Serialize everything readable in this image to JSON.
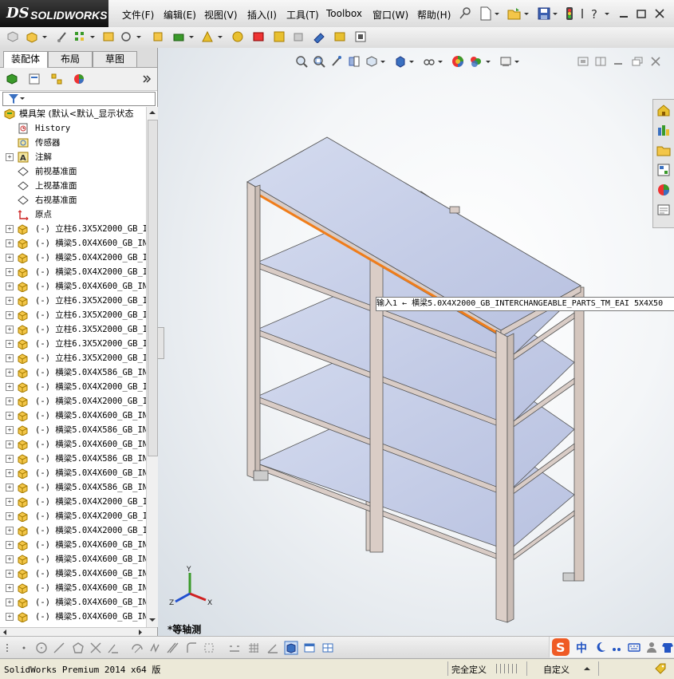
{
  "app": {
    "logo_ds": "DS",
    "logo_text": "SOLIDWORKS",
    "status_version": "SolidWorks Premium 2014 x64 版",
    "status_define": "完全定义",
    "status_custom": "自定义"
  },
  "menu": [
    {
      "label": "文件(F)"
    },
    {
      "label": "编辑(E)"
    },
    {
      "label": "视图(V)"
    },
    {
      "label": "插入(I)"
    },
    {
      "label": "工具(T)"
    },
    {
      "label": "Toolbox"
    },
    {
      "label": "窗口(W)"
    },
    {
      "label": "帮助(H)"
    }
  ],
  "tabs": [
    {
      "label": "装配体"
    },
    {
      "label": "布局"
    },
    {
      "label": "草图"
    }
  ],
  "tree": {
    "root": "模具架  (默认<默认_显示状态",
    "items": [
      {
        "label": "History",
        "icon": "history-icon",
        "expand": false
      },
      {
        "label": "传感器",
        "icon": "sensor-icon",
        "expand": false
      },
      {
        "label": "注解",
        "icon": "annotation-icon",
        "expand": true
      },
      {
        "label": "前视基准面",
        "icon": "plane-icon",
        "expand": false
      },
      {
        "label": "上视基准面",
        "icon": "plane-icon",
        "expand": false
      },
      {
        "label": "右视基准面",
        "icon": "plane-icon",
        "expand": false
      },
      {
        "label": "原点",
        "icon": "origin-icon",
        "expand": false
      },
      {
        "label": "(-) 立柱6.3X5X2000_GB_I",
        "icon": "part-icon",
        "expand": true
      },
      {
        "label": "(-) 横梁5.0X4X600_GB_IN",
        "icon": "part-icon",
        "expand": true
      },
      {
        "label": "(-) 横梁5.0X4X2000_GB_I",
        "icon": "part-icon",
        "expand": true
      },
      {
        "label": "(-) 横梁5.0X4X2000_GB_I",
        "icon": "part-icon",
        "expand": true
      },
      {
        "label": "(-) 横梁5.0X4X600_GB_IN",
        "icon": "part-icon",
        "expand": true
      },
      {
        "label": "(-) 立柱6.3X5X2000_GB_I",
        "icon": "part-icon",
        "expand": true
      },
      {
        "label": "(-) 立柱6.3X5X2000_GB_I",
        "icon": "part-icon",
        "expand": true
      },
      {
        "label": "(-) 立柱6.3X5X2000_GB_I",
        "icon": "part-icon",
        "expand": true
      },
      {
        "label": "(-) 立柱6.3X5X2000_GB_I",
        "icon": "part-icon",
        "expand": true
      },
      {
        "label": "(-) 立柱6.3X5X2000_GB_I",
        "icon": "part-icon",
        "expand": true
      },
      {
        "label": "(-) 横梁5.0X4X586_GB_IN",
        "icon": "part-icon",
        "expand": true
      },
      {
        "label": "(-) 横梁5.0X4X2000_GB_I",
        "icon": "part-icon",
        "expand": true
      },
      {
        "label": "(-) 横梁5.0X4X2000_GB_I",
        "icon": "part-icon",
        "expand": true
      },
      {
        "label": "(-) 横梁5.0X4X600_GB_IN",
        "icon": "part-icon",
        "expand": true
      },
      {
        "label": "(-) 横梁5.0X4X586_GB_IN",
        "icon": "part-icon",
        "expand": true
      },
      {
        "label": "(-) 横梁5.0X4X600_GB_IN",
        "icon": "part-icon",
        "expand": true
      },
      {
        "label": "(-) 横梁5.0X4X586_GB_IN",
        "icon": "part-icon",
        "expand": true
      },
      {
        "label": "(-) 横梁5.0X4X600_GB_IN",
        "icon": "part-icon",
        "expand": true
      },
      {
        "label": "(-) 横梁5.0X4X586_GB_IN",
        "icon": "part-icon",
        "expand": true
      },
      {
        "label": "(-) 横梁5.0X4X2000_GB_I",
        "icon": "part-icon",
        "expand": true
      },
      {
        "label": "(-) 横梁5.0X4X2000_GB_I",
        "icon": "part-icon",
        "expand": true
      },
      {
        "label": "(-) 横梁5.0X4X2000_GB_I",
        "icon": "part-icon",
        "expand": true
      },
      {
        "label": "(-) 横梁5.0X4X600_GB_IN",
        "icon": "part-icon",
        "expand": true
      },
      {
        "label": "(-) 横梁5.0X4X600_GB_IN",
        "icon": "part-icon",
        "expand": true
      },
      {
        "label": "(-) 横梁5.0X4X600_GB_IN",
        "icon": "part-icon",
        "expand": true
      },
      {
        "label": "(-) 横梁5.0X4X600_GB_IN",
        "icon": "part-icon",
        "expand": true
      },
      {
        "label": "(-) 横梁5.0X4X600_GB_IN",
        "icon": "part-icon",
        "expand": true
      },
      {
        "label": "(-) 横梁5.0X4X600_GB_IN",
        "icon": "part-icon",
        "expand": true
      }
    ]
  },
  "viewport": {
    "tooltip": "输入1 ← 横梁5.0X4X2000_GB_INTERCHANGEABLE_PARTS_TM_EAI 5X4X50",
    "view_name": "*等轴测",
    "axis_x": "X",
    "axis_y": "Y",
    "axis_z": "Z"
  },
  "ime": {
    "lang": "中"
  },
  "colors": {
    "shelf": "#c4cce6",
    "frame": "#d9ccc6",
    "highlight": "#f07d1a",
    "background": "#ece9d8"
  }
}
